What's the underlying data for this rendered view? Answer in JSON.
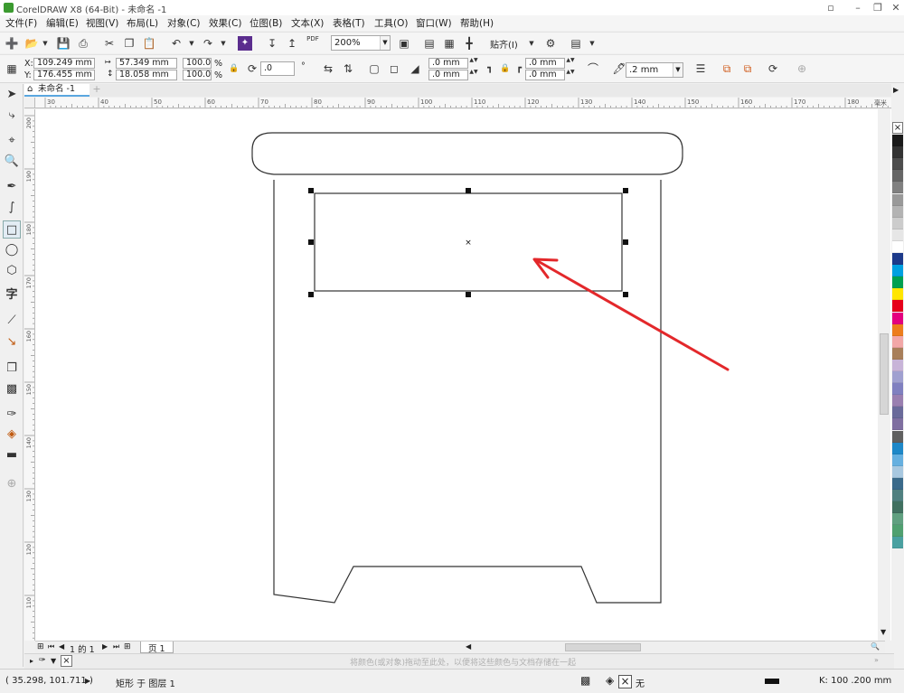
{
  "app": {
    "title": "CorelDRAW X8 (64-Bit) - 未命名 -1"
  },
  "menu": [
    "文件(F)",
    "编辑(E)",
    "视图(V)",
    "布局(L)",
    "对象(C)",
    "效果(C)",
    "位图(B)",
    "文本(X)",
    "表格(T)",
    "工具(O)",
    "窗口(W)",
    "帮助(H)"
  ],
  "standard_toolbar": {
    "zoom_value": "200%",
    "snap_label": "贴齐(I)",
    "pdf_label": "PDF"
  },
  "property_bar": {
    "x_label": "X:",
    "x_value": "109.249 mm",
    "y_label": "Y:",
    "y_value": "176.455 mm",
    "width_value": "57.349 mm",
    "height_value": "18.058 mm",
    "scale_x": "100.0",
    "scale_y": "100.0",
    "percent": "%",
    "rotation": ".0",
    "corner_top": ".0 mm",
    "corner_bottom": ".0 mm",
    "corner_top_right": ".0 mm",
    "corner_bottom_right": ".0 mm",
    "outline_width": ".2 mm"
  },
  "document_tab": {
    "label": "未命名 -1"
  },
  "rulers": {
    "unit": "毫米",
    "h_ticks": [
      "30",
      "40",
      "50",
      "60",
      "70",
      "80",
      "90",
      "100",
      "110",
      "120",
      "130",
      "140",
      "150",
      "160",
      "170",
      "180"
    ],
    "v_ticks": [
      "200",
      "190",
      "180",
      "170",
      "160",
      "150",
      "140",
      "130",
      "120",
      "110"
    ]
  },
  "page_nav": {
    "page_count": "1 的 1",
    "page_tab": "页 1"
  },
  "hint_text": "将颜色(或对象)拖动至此处，以便将这些颜色与文档存储在一起",
  "status": {
    "cursor_pos": "( 35.298, 101.711 )",
    "selection_info": "矩形 于 图层 1",
    "fill_none": "无",
    "outline_info": "K: 100  .200 mm"
  },
  "palette_colors": [
    "#1a1a1a",
    "#333333",
    "#4d4d4d",
    "#666666",
    "#808080",
    "#999999",
    "#b3b3b3",
    "#cccccc",
    "#e6e6e6",
    "#ffffff",
    "#1d3a8a",
    "#00a0e0",
    "#00a050",
    "#ffe600",
    "#e6001a",
    "#e4007f",
    "#ed7d1c",
    "#f2a7a7",
    "#a87f5a",
    "#c8b4d8",
    "#a0a0d0",
    "#8080c0",
    "#9a7fb0",
    "#6a6a9a",
    "#7f6fa0",
    "#606060",
    "#1e88c8",
    "#66b0e0",
    "#a8c8e0",
    "#3a6a8a",
    "#508080",
    "#407060",
    "#60a080",
    "#50a070",
    "#4aa0a0"
  ],
  "colors": {
    "accent_arrow": "#e3282b",
    "tab_underline": "#5aa7e0"
  }
}
